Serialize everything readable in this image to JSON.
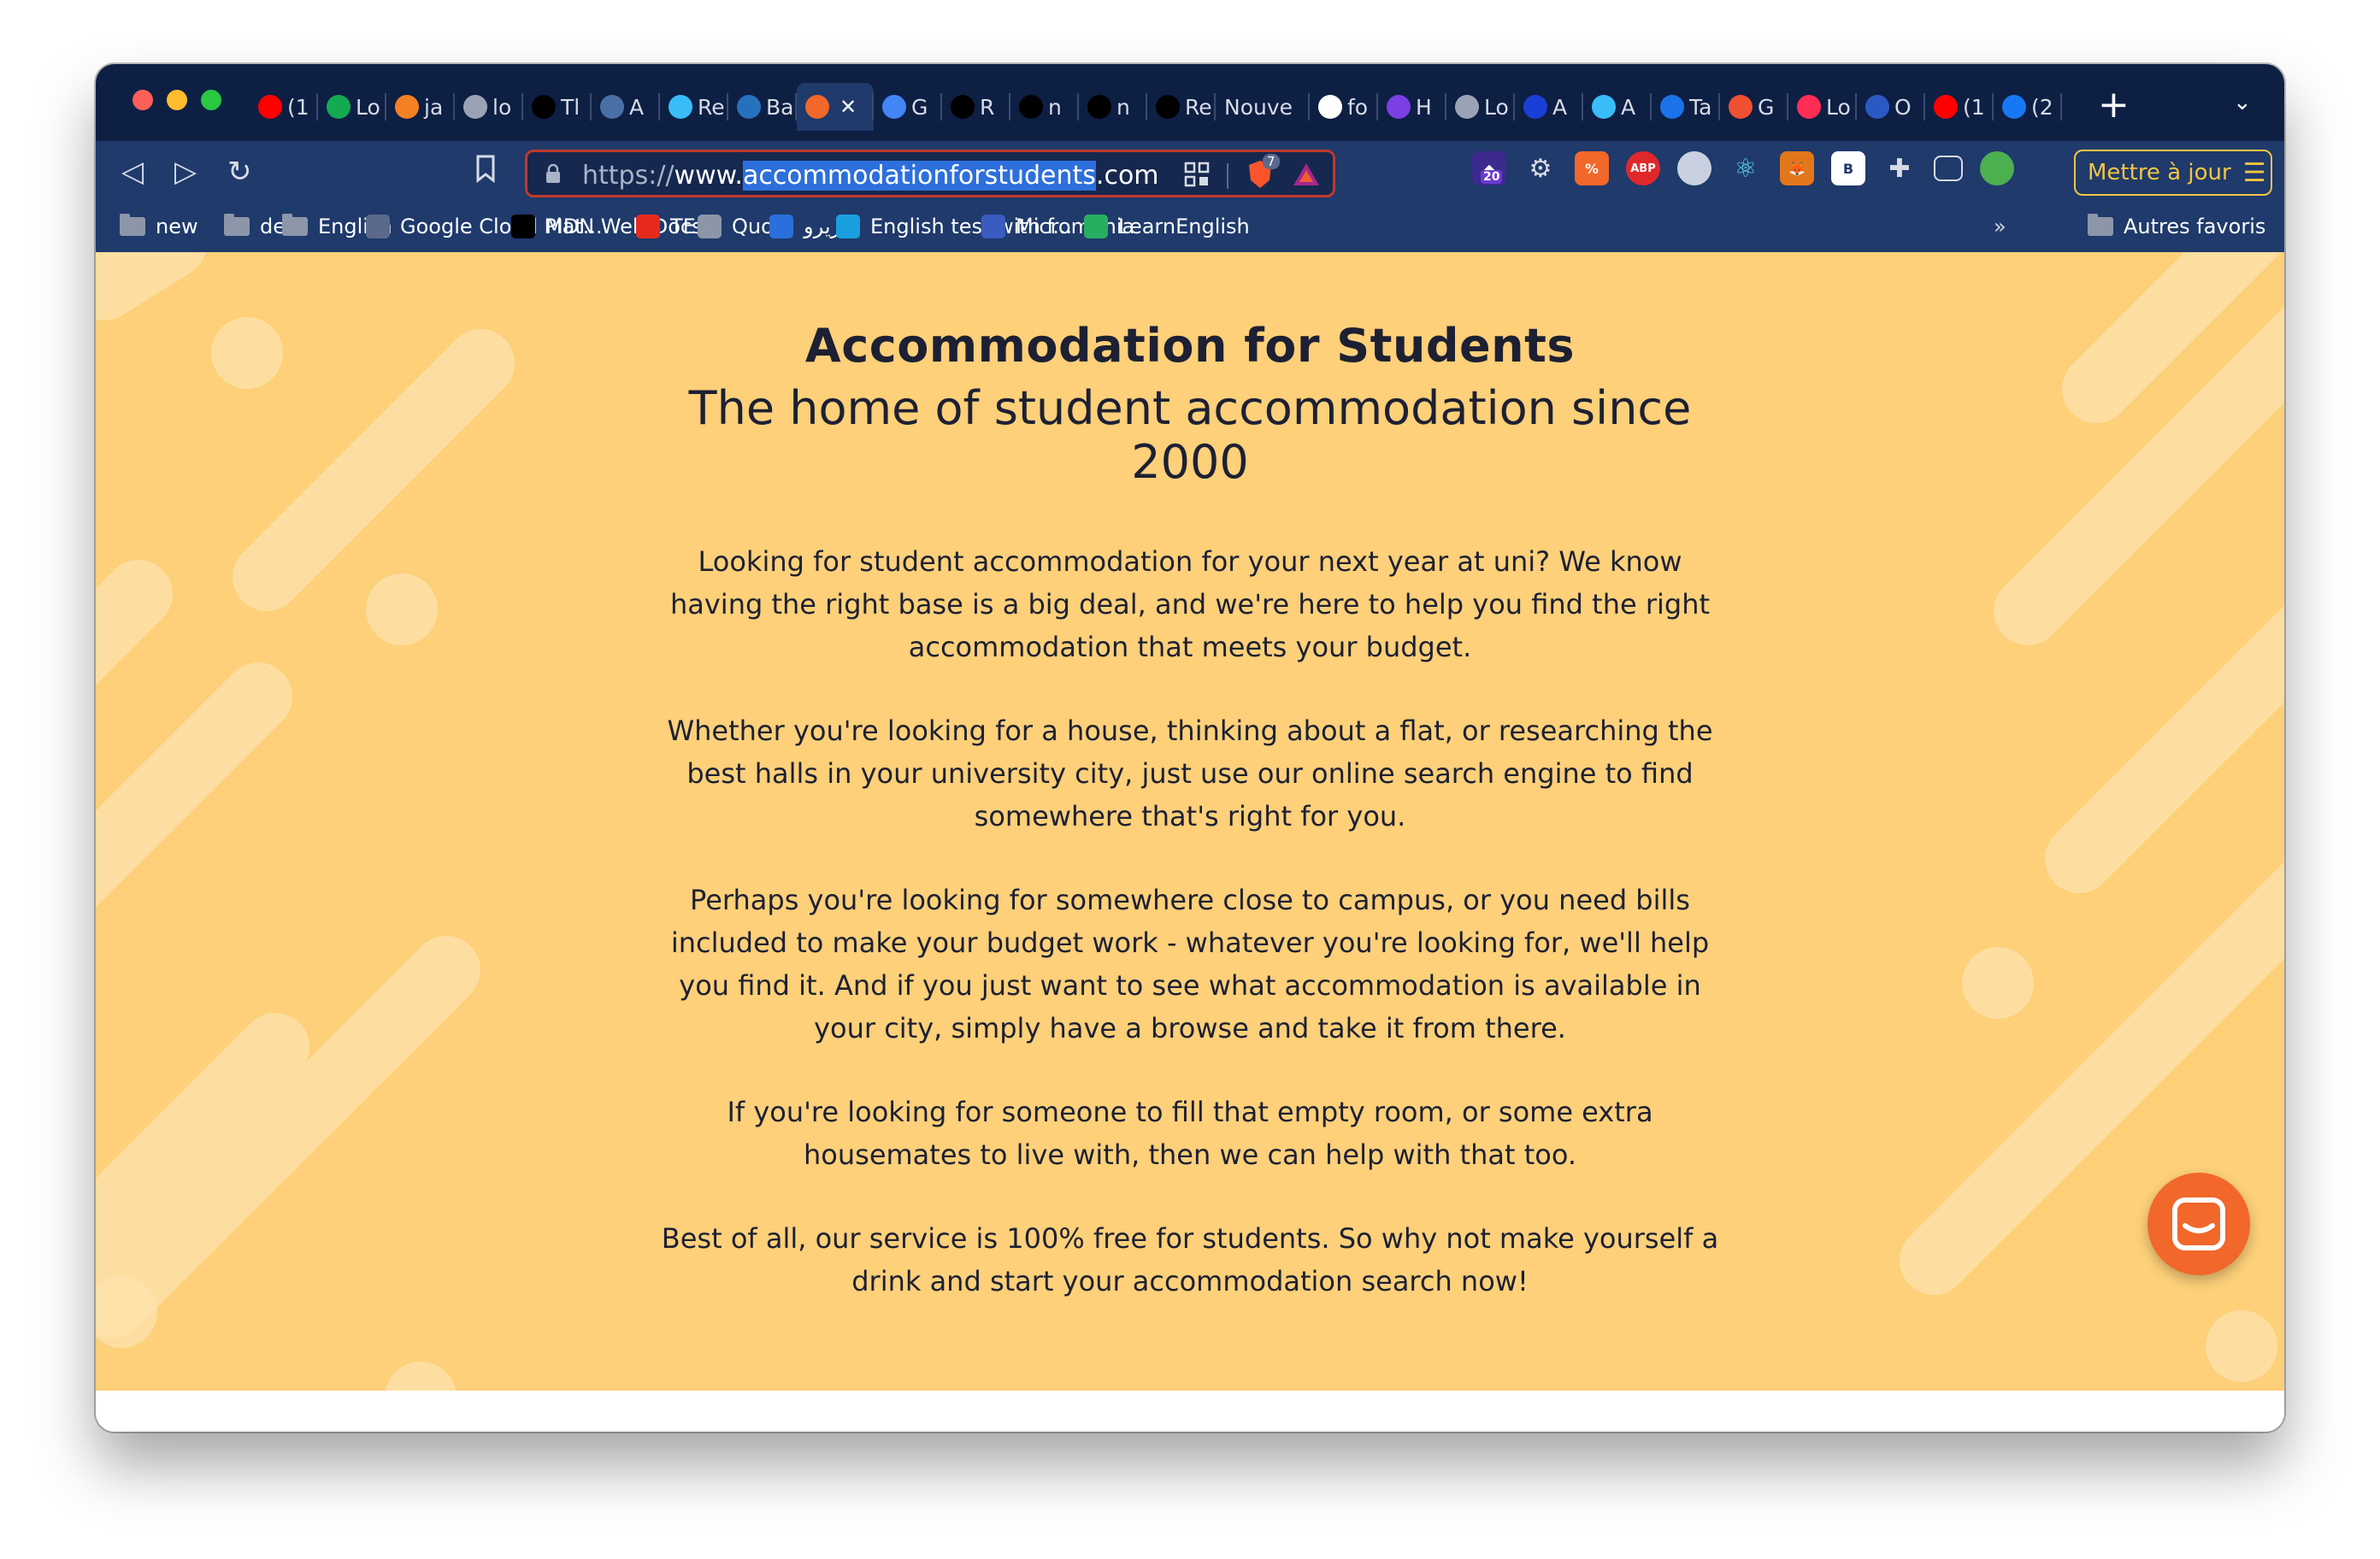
{
  "browser": {
    "tabs": [
      {
        "label": "(1",
        "icon": "youtube-icon",
        "color": "#ff0000"
      },
      {
        "label": "Lo",
        "icon": "leaf-icon",
        "color": "#13aa52"
      },
      {
        "label": "ja",
        "icon": "stackoverflow-icon",
        "color": "#f48024"
      },
      {
        "label": "lo",
        "icon": "globe-icon",
        "color": "#9aa3b5"
      },
      {
        "label": "Tl",
        "icon": "jetbrains-icon",
        "color": "#000000"
      },
      {
        "label": "A",
        "icon": "gt-icon",
        "color": "#4a6fa5"
      },
      {
        "label": "Re",
        "icon": "tailwind-icon",
        "color": "#38bdf8"
      },
      {
        "label": "Ba",
        "icon": "powershell-icon",
        "color": "#2671be"
      },
      {
        "label": "",
        "icon": "house-icon",
        "color": "#f2672a",
        "active": true
      },
      {
        "label": "G",
        "icon": "translate-icon",
        "color": "#4285f4"
      },
      {
        "label": "R",
        "icon": "notion-icon",
        "color": "#000000"
      },
      {
        "label": "n",
        "icon": "github-icon",
        "color": "#000000"
      },
      {
        "label": "n",
        "icon": "notion-icon",
        "color": "#000000"
      },
      {
        "label": "Re",
        "icon": "vercel-icon",
        "color": "#000000"
      },
      {
        "label": "Nouve",
        "icon": "",
        "color": "#1f3a6b"
      },
      {
        "label": "fo",
        "icon": "google-icon",
        "color": "#ffffff"
      },
      {
        "label": "H",
        "icon": "shield-icon",
        "color": "#7b3fe4"
      },
      {
        "label": "Lo",
        "icon": "globe-icon",
        "color": "#9aa3b5"
      },
      {
        "label": "A",
        "icon": "js-icon",
        "color": "#1a3fd6"
      },
      {
        "label": "A",
        "icon": "tailwind-icon",
        "color": "#38bdf8"
      },
      {
        "label": "Ta",
        "icon": "play-icon",
        "color": "#1a73e8"
      },
      {
        "label": "G",
        "icon": "git-icon",
        "color": "#f05032"
      },
      {
        "label": "Lo",
        "icon": "tt-icon",
        "color": "#ff2d55"
      },
      {
        "label": "O",
        "icon": "cube-icon",
        "color": "#2b59c3"
      },
      {
        "label": "(1",
        "icon": "youtube-icon",
        "color": "#ff0000"
      },
      {
        "label": "(2",
        "icon": "facebook-icon",
        "color": "#1877f2"
      }
    ],
    "url": {
      "scheme": "https://",
      "prefix": "www.",
      "highlighted": "accommodationforstudents",
      "suffix": ".com"
    },
    "brave_shield_count": "7",
    "extension_badge": "20",
    "update_button_label": "Mettre à jour",
    "bookmarks": [
      {
        "label": "new",
        "type": "folder"
      },
      {
        "label": "dev",
        "type": "folder"
      },
      {
        "label": "English",
        "type": "folder"
      },
      {
        "label": "Google Cloud Plat...",
        "type": "link",
        "icon": "gcp-icon"
      },
      {
        "label": "MDN Web Docs",
        "type": "link",
        "icon": "mdn-icon"
      },
      {
        "label": "TED",
        "type": "link",
        "icon": "ted-icon"
      },
      {
        "label": "Quora",
        "type": "link",
        "icon": "globe-icon"
      },
      {
        "label": "الزيرو",
        "type": "link",
        "icon": "e-icon"
      },
      {
        "label": "English test with f...",
        "type": "link",
        "icon": "ef-icon"
      },
      {
        "label": "Micromania",
        "type": "link",
        "icon": "micromania-icon"
      },
      {
        "label": "LearnEnglish",
        "type": "link",
        "icon": "learnenglish-icon"
      }
    ],
    "overflow_label": "»",
    "other_bookmarks_label": "Autres favoris"
  },
  "page": {
    "heading": "Accommodation for Students",
    "subheading": "The home of student accommodation since 2000",
    "paragraphs": [
      "Looking for student accommodation for your next year at uni? We know having the right base is a big deal, and we're here to help you find the right accommodation that meets your budget.",
      "Whether you're looking for a house, thinking about a flat, or researching the best halls in your university city, just use our online search engine to find somewhere that's right for you.",
      "Perhaps you're looking for somewhere close to campus, or you need bills included to make your budget work - whatever you're looking for, we'll help you find it. And if you just want to see what accommodation is available in your city, simply have a browse and take it from there.",
      "If you're looking for someone to fill that empty room, or some extra housemates to live with, then we can help with that too.",
      "Best of all, our service is 100% free for students. So why not make yourself a drink and start your accommodation search now!"
    ],
    "colors": {
      "background": "#fdd079",
      "text": "#1d2033",
      "chat_button": "#f2672a"
    }
  }
}
